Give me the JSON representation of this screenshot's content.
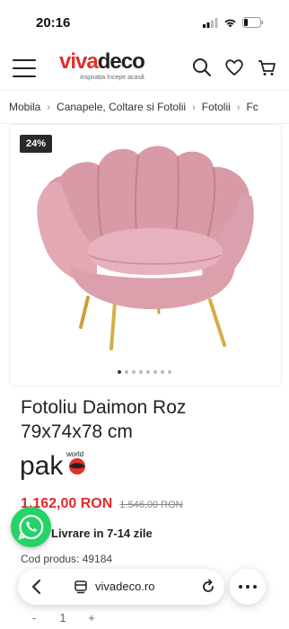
{
  "status": {
    "time": "20:16"
  },
  "header": {
    "logo_viva": "viva",
    "logo_deco": "deco",
    "tagline": "inspirația începe acasă"
  },
  "breadcrumb": [
    "Mobila",
    "Canapele, Coltare si Fotolii",
    "Fotolii",
    "Fc"
  ],
  "product": {
    "discount_badge": "24%",
    "title": "Fotoliu Daimon Roz 79x74x78 cm",
    "brand_main": "pak",
    "brand_world": "world",
    "price_now": "1.162,00 RON",
    "price_old": "1.546,00 RON",
    "delivery": "Livrare in 7-14 zile",
    "code_label": "Cod produs: 49184",
    "qty_minus": "-",
    "qty_value": "1",
    "qty_plus": "+"
  },
  "gallery": {
    "dots": 8,
    "active": 0
  },
  "browser": {
    "url": "vivadeco.ro"
  },
  "colors": {
    "brand_red": "#e0302b",
    "price_red": "#e02a2a",
    "chair_pink": "#dfa4b0",
    "whatsapp": "#25d366"
  }
}
